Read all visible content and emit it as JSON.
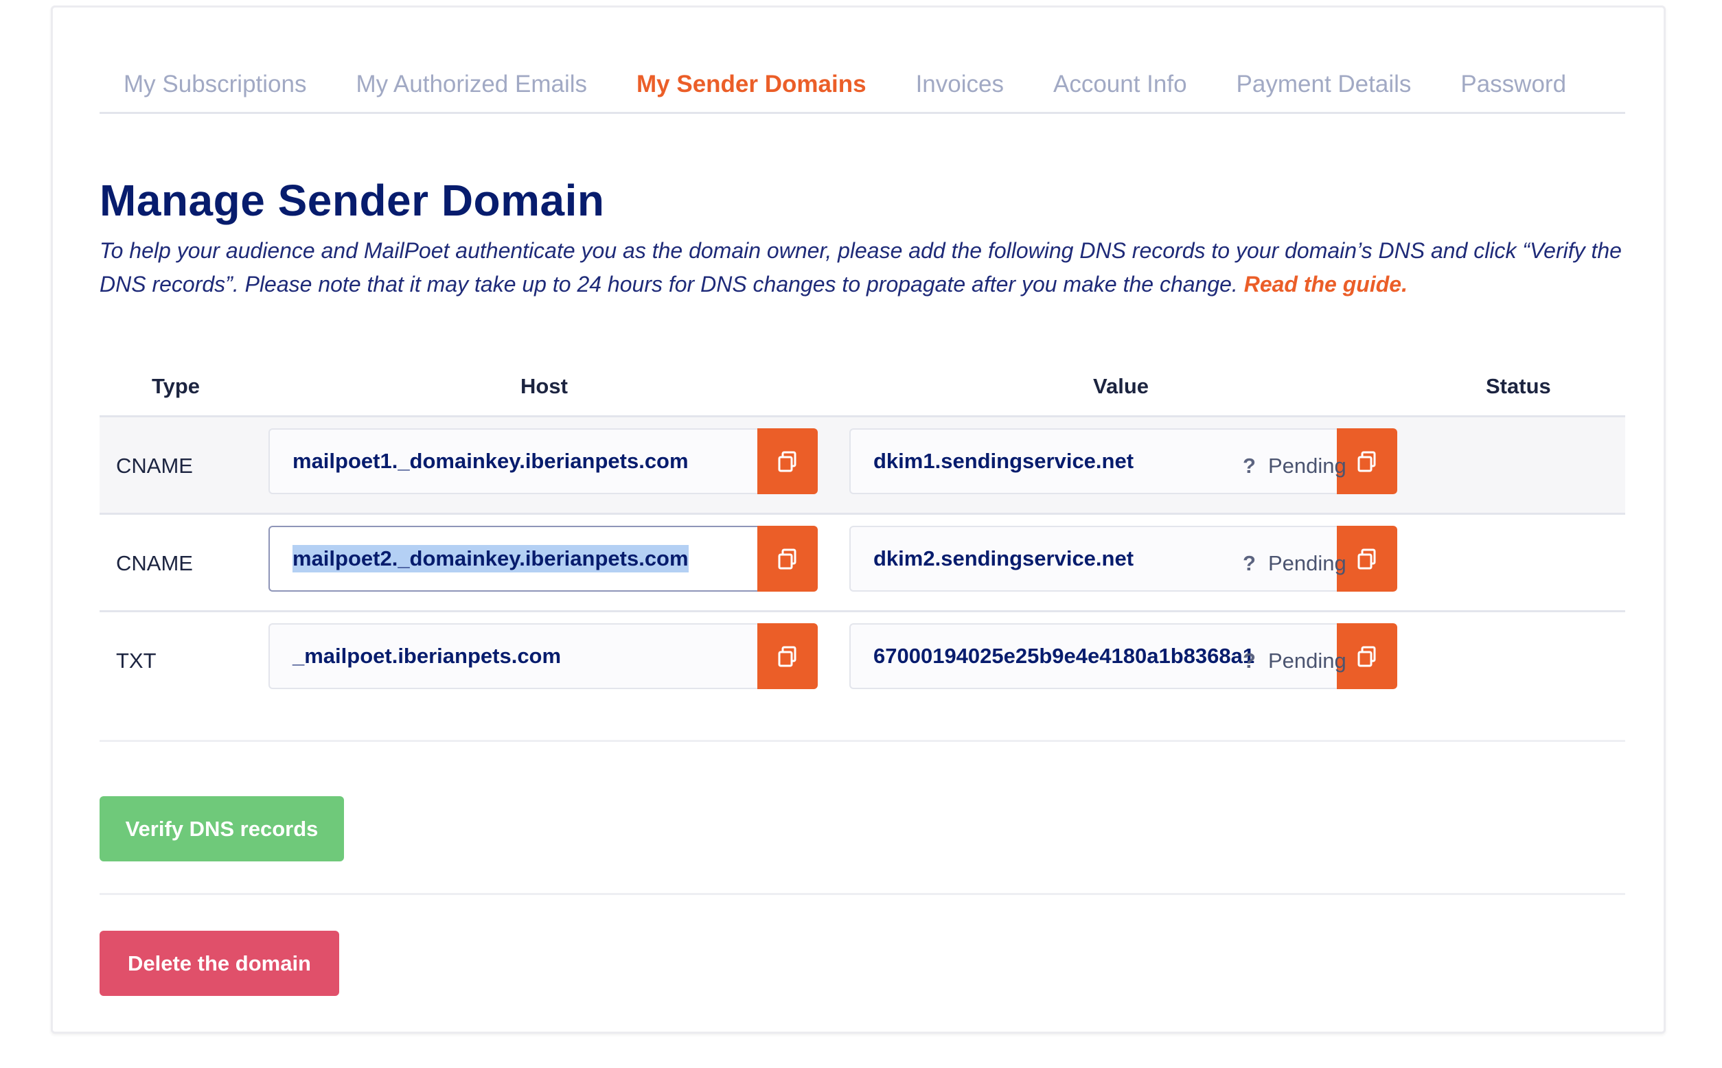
{
  "tabs": [
    {
      "label": "My Subscriptions",
      "active": false
    },
    {
      "label": "My Authorized Emails",
      "active": false
    },
    {
      "label": "My Sender Domains",
      "active": true
    },
    {
      "label": "Invoices",
      "active": false
    },
    {
      "label": "Account Info",
      "active": false
    },
    {
      "label": "Payment Details",
      "active": false
    },
    {
      "label": "Password",
      "active": false
    }
  ],
  "page": {
    "title": "Manage Sender Domain",
    "description": "To help your audience and MailPoet authenticate you as the domain owner, please add the following DNS records to your domain’s DNS and click “Verify the DNS records”. Please note that it may take up to 24 hours for DNS changes to propagate after you make the change.",
    "guide_link": "Read the guide."
  },
  "table": {
    "headers": {
      "type": "Type",
      "host": "Host",
      "value": "Value",
      "status": "Status"
    },
    "rows": [
      {
        "type": "CNAME",
        "host": "mailpoet1._domainkey.iberianpets.com",
        "value": "dkim1.sendingservice.net",
        "status": "Pending"
      },
      {
        "type": "CNAME",
        "host": "mailpoet2._domainkey.iberianpets.com",
        "value": "dkim2.sendingservice.net",
        "status": "Pending"
      },
      {
        "type": "TXT",
        "host": "_mailpoet.iberianpets.com",
        "value": "67000194025e25b9e4e4180a1b8368a1",
        "status": "Pending"
      }
    ],
    "status_icon": "question-mark-icon",
    "copy_icon": "copy-icon"
  },
  "buttons": {
    "verify": "Verify DNS records",
    "delete": "Delete the domain"
  },
  "colors": {
    "accent": "#eb5e28",
    "title": "#071c6d",
    "verify": "#6fc97a",
    "delete": "#e0506a",
    "selection": "#b4d0f4"
  }
}
